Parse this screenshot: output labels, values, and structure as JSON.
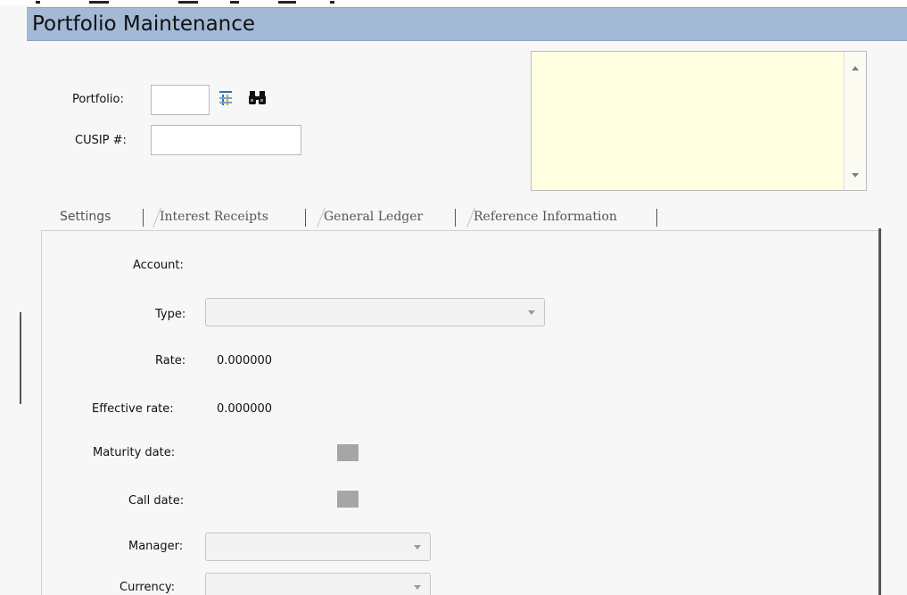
{
  "window": {
    "title": "Portfolio Maintenance"
  },
  "header": {
    "portfolio_label": "Portfolio:",
    "portfolio_value": "",
    "cusip_label": "CUSIP #:",
    "cusip_value": "",
    "list_icon": "list-icon",
    "search_icon": "binoculars-icon",
    "notes_value": ""
  },
  "tabs": [
    {
      "label": "Settings",
      "active": true
    },
    {
      "label": "Interest Receipts",
      "active": false
    },
    {
      "label": "General Ledger",
      "active": false
    },
    {
      "label": "Reference Information",
      "active": false
    }
  ],
  "settings": {
    "account_label": "Account:",
    "type_label": "Type:",
    "type_value": "",
    "rate_label": "Rate:",
    "rate_value": "0.000000",
    "effective_rate_label": "Effective rate:",
    "effective_rate_value": "0.000000",
    "maturity_date_label": "Maturity date:",
    "call_date_label": "Call date:",
    "manager_label": "Manager:",
    "manager_value": "",
    "currency_label": "Currency:",
    "currency_value": ""
  },
  "colors": {
    "title_bar": "#a3b9d6",
    "notes_background": "#fffee0"
  }
}
